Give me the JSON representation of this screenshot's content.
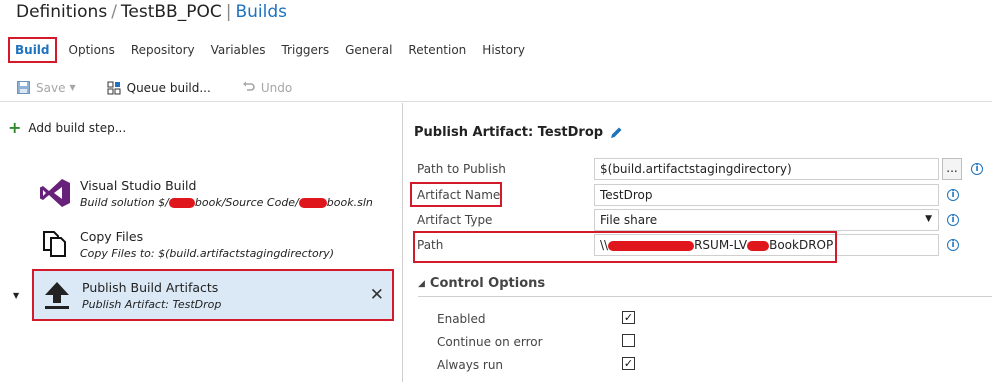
{
  "breadcrumb": {
    "root": "Definitions",
    "separator": "/",
    "definition": "TestBB_POC",
    "divider": "|",
    "current": "Builds"
  },
  "tabs": [
    {
      "label": "Build",
      "active": true
    },
    {
      "label": "Options"
    },
    {
      "label": "Repository"
    },
    {
      "label": "Variables"
    },
    {
      "label": "Triggers"
    },
    {
      "label": "General"
    },
    {
      "label": "Retention"
    },
    {
      "label": "History"
    }
  ],
  "toolbar": {
    "save_label": "Save",
    "queue_label": "Queue build...",
    "undo_label": "Undo"
  },
  "left": {
    "add_step_label": "Add build step...",
    "steps": [
      {
        "title": "Visual Studio Build",
        "sub_prefix": "Build solution $/",
        "sub_mid": "book/Source Code/",
        "sub_suffix": "book.sln",
        "icon": "visual-studio-icon"
      },
      {
        "title": "Copy Files",
        "sub": "Copy Files to: $(build.artifactstagingdirectory)",
        "icon": "copy-files-icon"
      },
      {
        "title": "Publish Build Artifacts",
        "sub": "Publish Artifact: TestDrop",
        "icon": "upload-icon",
        "selected": true
      }
    ]
  },
  "right": {
    "title": "Publish Artifact: TestDrop",
    "fields": {
      "path_to_publish": {
        "label": "Path to Publish",
        "value": "$(build.artifactstagingdirectory)"
      },
      "artifact_name": {
        "label": "Artifact Name",
        "value": "TestDrop"
      },
      "artifact_type": {
        "label": "Artifact Type",
        "value": "File share"
      },
      "path": {
        "label": "Path",
        "value_prefix": "\\\\",
        "value_mid": "RSUM-LV",
        "value_suffix": "BookDROP"
      }
    },
    "ellipsis": "...",
    "control_options": {
      "title": "Control Options",
      "enabled": {
        "label": "Enabled",
        "checked": true
      },
      "continue_on_error": {
        "label": "Continue on error",
        "checked": false
      },
      "always_run": {
        "label": "Always run",
        "checked": true
      }
    }
  },
  "colors": {
    "accent": "#1e73be",
    "highlight": "#d21a2a",
    "selected_bg": "#dbe9f7",
    "add_green": "#2e8b2e",
    "vs_purple": "#68217a"
  }
}
